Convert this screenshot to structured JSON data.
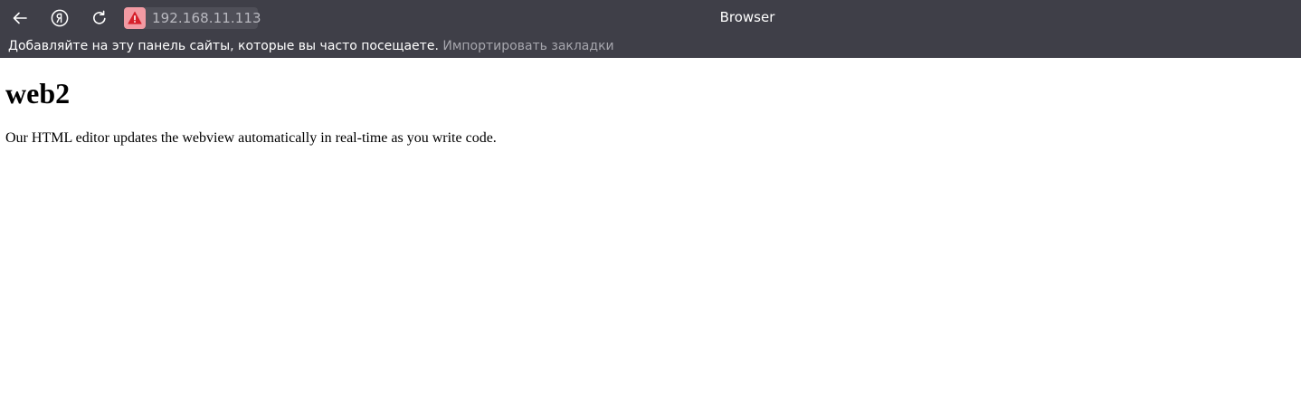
{
  "toolbar": {
    "back_icon": "arrow-left-icon",
    "yandex_icon": "yandex-circle-icon",
    "reload_icon": "reload-icon",
    "security_icon": "warning-triangle-icon",
    "url": "192.168.11.113",
    "window_title": "Browser"
  },
  "bookmarks_bar": {
    "hint": "Добавляйте на эту панель сайты, которые вы часто посещаете.",
    "import_link": "Импортировать закладки"
  },
  "content": {
    "heading": "web2",
    "paragraph": "Our HTML editor updates the webview automatically in real-time as you write code."
  },
  "colors": {
    "chrome_bg": "#3f3f48",
    "urlbar_bg": "#4f4f58",
    "warning_badge": "#f29aa3",
    "warning_icon": "#d6202b"
  }
}
